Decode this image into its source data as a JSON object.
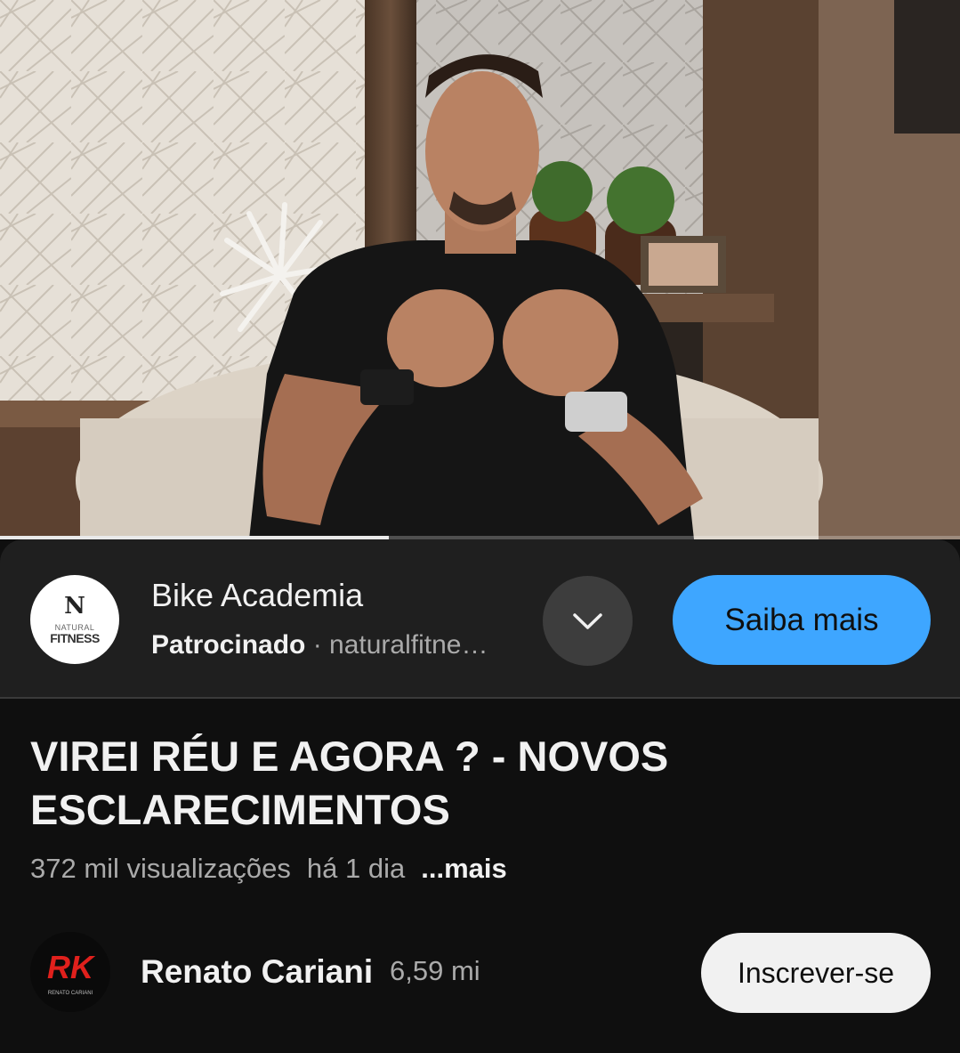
{
  "video": {
    "progress_fraction": 0.405
  },
  "ad": {
    "logo": {
      "mark": "N",
      "line1": "NATURAL",
      "line2": "FITNESS"
    },
    "title": "Bike Academia",
    "sponsored_label": "Patrocinado",
    "separator": " · ",
    "domain": "naturalfitne…",
    "expand_icon": "chevron-down-icon",
    "cta_label": "Saiba mais",
    "cta_color": "#3ea6ff"
  },
  "video_info": {
    "title": "VIREI RÉU E AGORA ? - NOVOS ESCLARECIMENTOS",
    "views": "372 mil visualizações",
    "age": "há 1 dia",
    "more_label": "...mais"
  },
  "channel": {
    "avatar_mark": "RK",
    "avatar_caption": "RENATO CARIANI",
    "name": "Renato Cariani",
    "subscribers": "6,59 mi",
    "subscribe_label": "Inscrever-se"
  }
}
